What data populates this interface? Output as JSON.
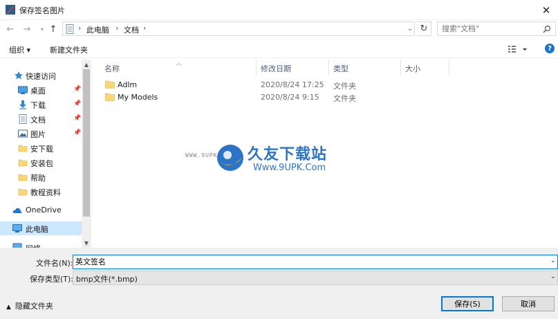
{
  "window": {
    "title": "保存签名图片"
  },
  "address": {
    "crumbs": [
      "此电脑",
      "文档"
    ]
  },
  "search": {
    "placeholder": "搜索\"文档\""
  },
  "toolbar": {
    "organize": "组织 ▾",
    "new_folder": "新建文件夹"
  },
  "nav": {
    "quick_access": "快速访问",
    "items": [
      {
        "label": "桌面",
        "icon": "desktop-icon",
        "pinned": true
      },
      {
        "label": "下载",
        "icon": "download-icon",
        "pinned": true
      },
      {
        "label": "文档",
        "icon": "document-icon",
        "pinned": true
      },
      {
        "label": "图片",
        "icon": "picture-icon",
        "pinned": true
      },
      {
        "label": "安下载",
        "icon": "folder-icon",
        "pinned": false
      },
      {
        "label": "安装包",
        "icon": "folder-icon",
        "pinned": false
      },
      {
        "label": "帮助",
        "icon": "folder-icon",
        "pinned": false
      },
      {
        "label": "教程资料",
        "icon": "folder-icon",
        "pinned": false
      }
    ],
    "onedrive": "OneDrive",
    "this_pc": "此电脑",
    "network": "网络"
  },
  "columns": {
    "name": "名称",
    "modified": "修改日期",
    "type": "类型",
    "size": "大小"
  },
  "files": [
    {
      "name": "Adlm",
      "modified": "2020/8/24 17:25",
      "type": "文件夹"
    },
    {
      "name": "My Models",
      "modified": "2020/8/24 9:15",
      "type": "文件夹"
    }
  ],
  "watermark": {
    "brand": "久友下载站",
    "url": "Www.9UPK.Com",
    "side": "WWW.9UPK.COM"
  },
  "form": {
    "filename_label": "文件名(N):",
    "filename_value": "英文签名",
    "filetype_label": "保存类型(T):",
    "filetype_value": "bmp文件(*.bmp)",
    "hide_folders": "隐藏文件夹",
    "save": "保存(S)",
    "cancel": "取消"
  },
  "colors": {
    "accent": "#0078d7",
    "selected": "#cce8ff",
    "folder": "#f8d775"
  }
}
